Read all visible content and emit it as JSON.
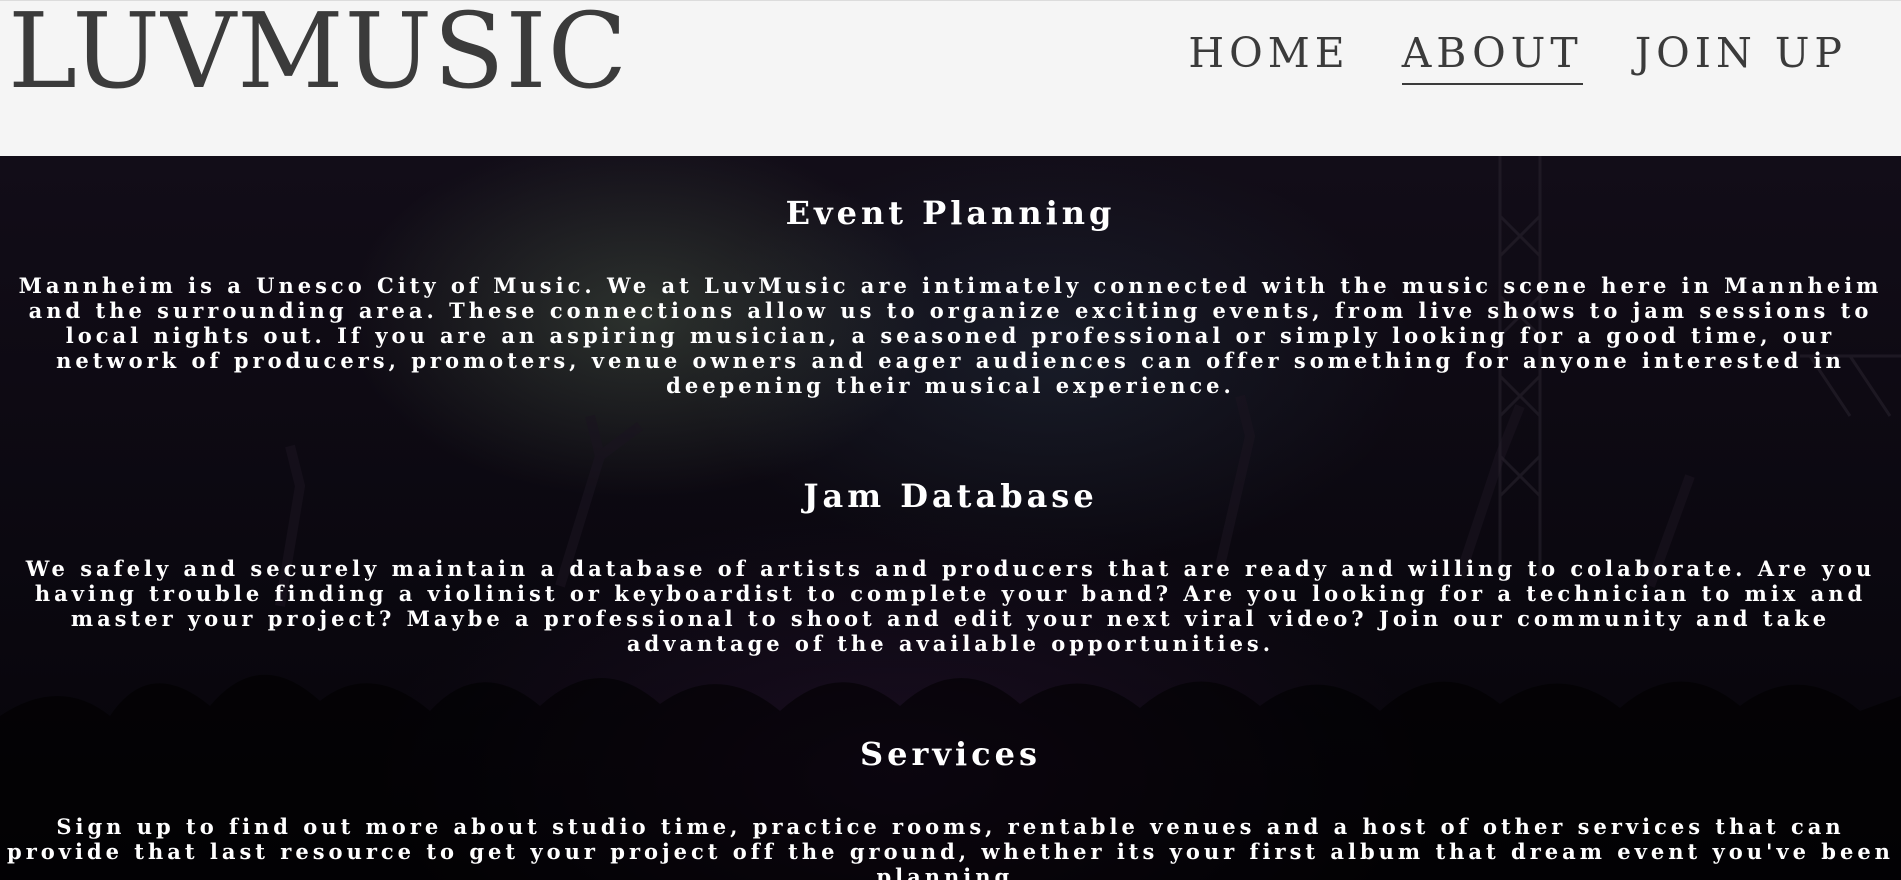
{
  "header": {
    "logo": "LUVMUSIC",
    "nav": [
      {
        "label": "HOME"
      },
      {
        "label": "ABOUT"
      },
      {
        "label": "JOIN UP"
      }
    ],
    "active_nav": "ABOUT"
  },
  "sections": [
    {
      "title": "Event Planning",
      "body": "Mannheim is a Unesco City of Music. We at LuvMusic are intimately connected with the music scene here in Mannheim and the surrounding area. These connections allow us to organize exciting events, from live shows to jam sessions to local nights out. If you are an aspiring musician, a seasoned professional or simply looking for a good time, our network of producers, promoters, venue owners and eager audiences can offer something for anyone interested in deepening their musical experience."
    },
    {
      "title": "Jam Database",
      "body": "We safely and securely maintain a database of artists and producers that are ready and willing to colaborate. Are you having trouble finding a violinist or keyboardist to complete your band? Are you looking for a technician to mix and master your project? Maybe a professional to shoot and edit your next viral video? Join our community and take advantage of the available opportunities."
    },
    {
      "title": "Services",
      "body": "Sign up to find out more about studio time, practice rooms, rentable venues and a host of other services that can provide that last resource to get your project off the ground, whether its your first album that dream event you've been planning."
    }
  ],
  "colors": {
    "header_bg": "#f5f5f5",
    "header_text": "#3b3b3b",
    "hero_text": "#ffffff",
    "hero_bg": "#0b0810"
  }
}
